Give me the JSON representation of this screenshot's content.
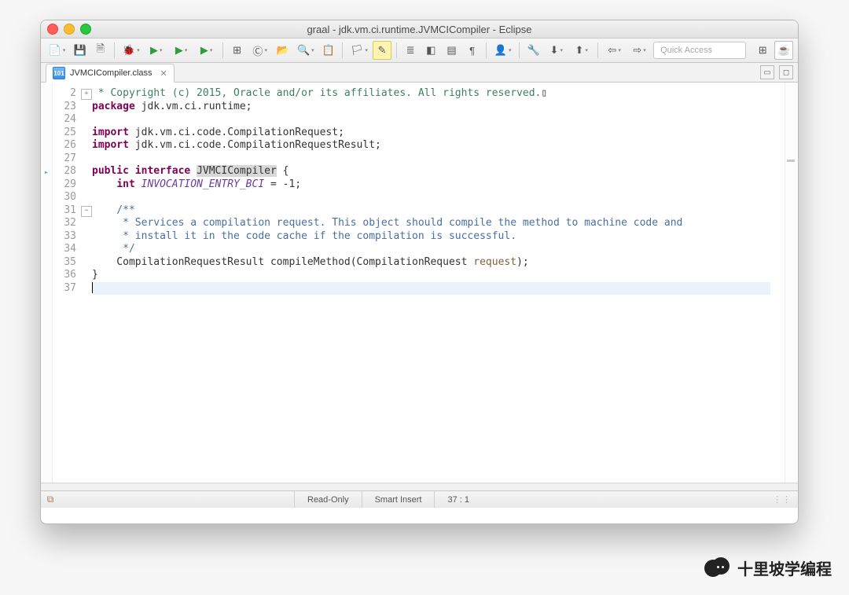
{
  "window": {
    "title": "graal - jdk.vm.ci.runtime.JVMCICompiler - Eclipse"
  },
  "toolbar": {
    "quick_access": "Quick Access"
  },
  "tab": {
    "label": "JVMCICompiler.class",
    "icon_text": "101"
  },
  "code": {
    "lines": [
      {
        "n": 2,
        "fold": "plus",
        "seg": [
          {
            "c": "cm",
            "t": " * Copyright (c) 2015, Oracle and/or its affiliates. All rights reserved."
          },
          {
            "c": "",
            "t": "▯"
          }
        ]
      },
      {
        "n": 23,
        "seg": [
          {
            "c": "kw",
            "t": "package"
          },
          {
            "c": "",
            "t": " jdk.vm.ci.runtime;"
          }
        ]
      },
      {
        "n": 24,
        "seg": [
          {
            "c": "",
            "t": ""
          }
        ]
      },
      {
        "n": 25,
        "seg": [
          {
            "c": "kw",
            "t": "import"
          },
          {
            "c": "",
            "t": " jdk.vm.ci.code.CompilationRequest;"
          }
        ]
      },
      {
        "n": 26,
        "seg": [
          {
            "c": "kw",
            "t": "import"
          },
          {
            "c": "",
            "t": " jdk.vm.ci.code.CompilationRequestResult;"
          }
        ]
      },
      {
        "n": 27,
        "seg": [
          {
            "c": "",
            "t": ""
          }
        ]
      },
      {
        "n": 28,
        "ann": "▸",
        "seg": [
          {
            "c": "kw",
            "t": "public"
          },
          {
            "c": "",
            "t": " "
          },
          {
            "c": "kw",
            "t": "interface"
          },
          {
            "c": "",
            "t": " "
          },
          {
            "c": "hlname",
            "t": "JVMCICompiler"
          },
          {
            "c": "",
            "t": " {"
          }
        ]
      },
      {
        "n": 29,
        "seg": [
          {
            "c": "",
            "t": "    "
          },
          {
            "c": "kw",
            "t": "int"
          },
          {
            "c": "",
            "t": " "
          },
          {
            "c": "st",
            "t": "INVOCATION_ENTRY_BCI"
          },
          {
            "c": "",
            "t": " = -1;"
          }
        ]
      },
      {
        "n": 30,
        "seg": [
          {
            "c": "",
            "t": ""
          }
        ]
      },
      {
        "n": 31,
        "fold": "minus",
        "seg": [
          {
            "c": "jd",
            "t": "    /**"
          }
        ]
      },
      {
        "n": 32,
        "seg": [
          {
            "c": "jd",
            "t": "     * Services a compilation request. This object should compile the method to machine code and"
          }
        ]
      },
      {
        "n": 33,
        "seg": [
          {
            "c": "jd",
            "t": "     * install it in the code cache if the compilation is successful."
          }
        ]
      },
      {
        "n": 34,
        "seg": [
          {
            "c": "jd",
            "t": "     */"
          }
        ]
      },
      {
        "n": 35,
        "seg": [
          {
            "c": "",
            "t": "    CompilationRequestResult compileMethod(CompilationRequest "
          },
          {
            "c": "prm",
            "t": "request"
          },
          {
            "c": "",
            "t": ");"
          }
        ]
      },
      {
        "n": 36,
        "seg": [
          {
            "c": "",
            "t": "}"
          }
        ]
      },
      {
        "n": 37,
        "caret": true,
        "hl": true,
        "seg": [
          {
            "c": "",
            "t": ""
          }
        ]
      }
    ]
  },
  "status": {
    "mode": "Read-Only",
    "insert": "Smart Insert",
    "pos": "37 : 1"
  },
  "watermark": "十里坡学编程"
}
